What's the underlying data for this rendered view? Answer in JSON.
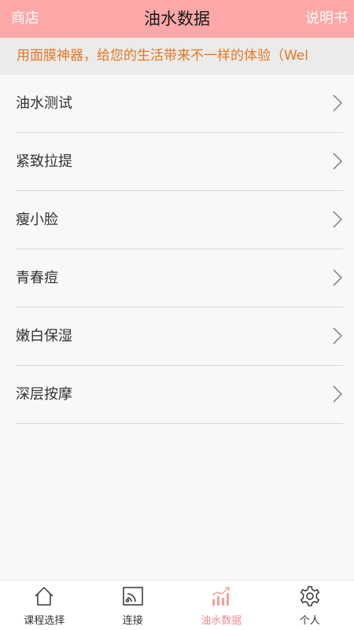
{
  "header": {
    "left_label": "商店",
    "title": "油水数据",
    "right_label": "说明书"
  },
  "marquee": {
    "text": "用面膜神器，给您的生活带来不一样的体验（Wel"
  },
  "list": {
    "items": [
      {
        "label": "油水测试"
      },
      {
        "label": "紧致拉提"
      },
      {
        "label": "瘦小脸"
      },
      {
        "label": "青春痘"
      },
      {
        "label": "嫩白保湿"
      },
      {
        "label": "深层按摩"
      }
    ]
  },
  "tabbar": {
    "tabs": [
      {
        "label": "课程选择",
        "icon": "home-icon"
      },
      {
        "label": "连接",
        "icon": "cast-icon"
      },
      {
        "label": "油水数据",
        "icon": "bar-chart-icon",
        "active": true
      },
      {
        "label": "个人",
        "icon": "gear-icon"
      }
    ]
  },
  "colors": {
    "header_bg": "#fda8a8",
    "marquee_text": "#e8771f",
    "active_tab": "#f08a8a"
  }
}
